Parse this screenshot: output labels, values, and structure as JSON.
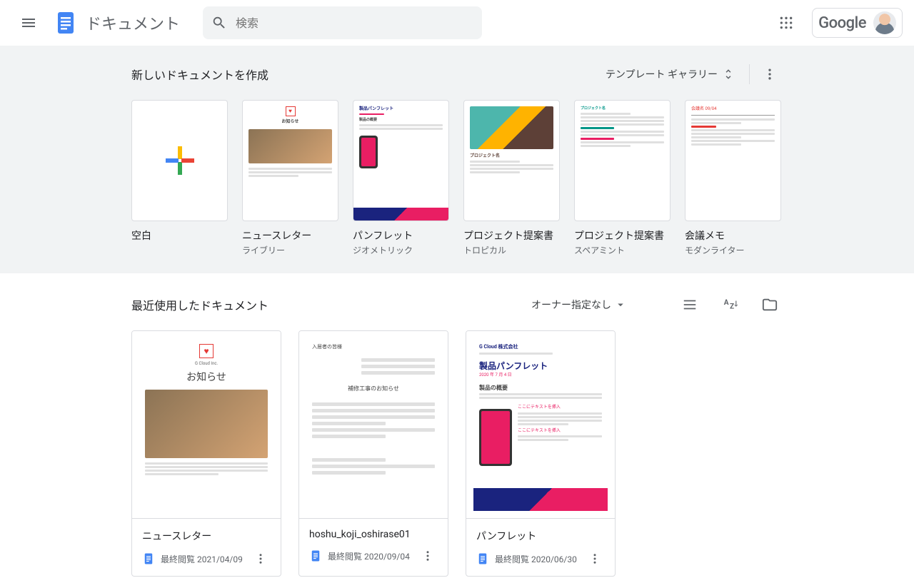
{
  "header": {
    "app_title": "ドキュメント",
    "search_placeholder": "検索",
    "google_label": "Google"
  },
  "templates": {
    "heading": "新しいドキュメントを作成",
    "gallery_label": "テンプレート ギャラリー",
    "items": [
      {
        "title": "空白",
        "subtitle": ""
      },
      {
        "title": "ニュースレター",
        "subtitle": "ライブリー"
      },
      {
        "title": "パンフレット",
        "subtitle": "ジオメトリック"
      },
      {
        "title": "プロジェクト提案書",
        "subtitle": "トロピカル"
      },
      {
        "title": "プロジェクト提案書",
        "subtitle": "スペアミント"
      },
      {
        "title": "会議メモ",
        "subtitle": "モダンライター"
      }
    ],
    "preview_text": {
      "newsletter_title": "お知らせ",
      "pamphlet_title": "製品パンフレット",
      "pamphlet_section": "製品の概要",
      "tropical_title": "プロジェクト名",
      "spearmint_title": "プロジェクト名",
      "meeting_title": "会議名 09/04"
    }
  },
  "recent": {
    "heading": "最近使用したドキュメント",
    "owner_filter": "オーナー指定なし",
    "docs": [
      {
        "title": "ニュースレター",
        "date": "最終閲覧 2021/04/09"
      },
      {
        "title": "hoshu_koji_oshirase01",
        "date": "最終閲覧 2020/09/04"
      },
      {
        "title": "パンフレット",
        "date": "最終閲覧 2020/06/30"
      }
    ],
    "preview_text": {
      "doc0_company": "G Cloud Inc.",
      "doc0_title": "お知らせ",
      "doc1_subject": "補修工事のお知らせ",
      "doc1_addressee": "入居者の皆様",
      "doc2_company": "G Cloud 株式会社",
      "doc2_title": "製品パンフレット",
      "doc2_date": "2020 年 7 月 4 日",
      "doc2_section": "製品の概要",
      "doc2_insert": "ここにテキストを挿入"
    }
  }
}
